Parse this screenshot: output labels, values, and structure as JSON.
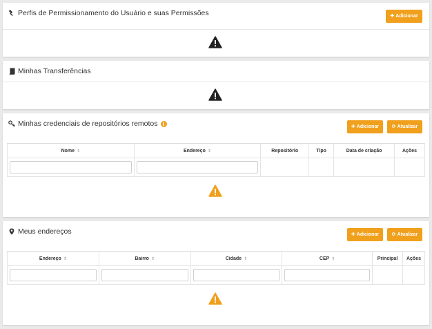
{
  "panels": {
    "profiles": {
      "title": "Perfis de Permissionamento do Usuário e suas Permissões",
      "add_label": "Adicionar"
    },
    "transfers": {
      "title": "Minhas Transferências"
    },
    "credentials": {
      "title": "Minhas credenciais de repositórios remotos",
      "add_label": "Adicionar",
      "refresh_label": "Atualizar",
      "columns": [
        "Nome",
        "Endereço",
        "Repositório",
        "Tipo",
        "Data de criação",
        "Ações"
      ]
    },
    "addresses": {
      "title": "Meus endereços",
      "add_label": "Adicionar",
      "refresh_label": "Atualizar",
      "columns": [
        "Endereço",
        "Bairro",
        "Cidade",
        "CEP",
        "Principal",
        "Ações"
      ]
    }
  },
  "icons": {
    "profiles": "gavel-icon",
    "transfers": "book-icon",
    "credentials": "key-icon",
    "addresses": "map-marker-icon",
    "warning": "warning-icon"
  },
  "colors": {
    "accent": "#f0a01c",
    "warning_dark": "#222222",
    "warning_orange": "#f0a01c"
  }
}
